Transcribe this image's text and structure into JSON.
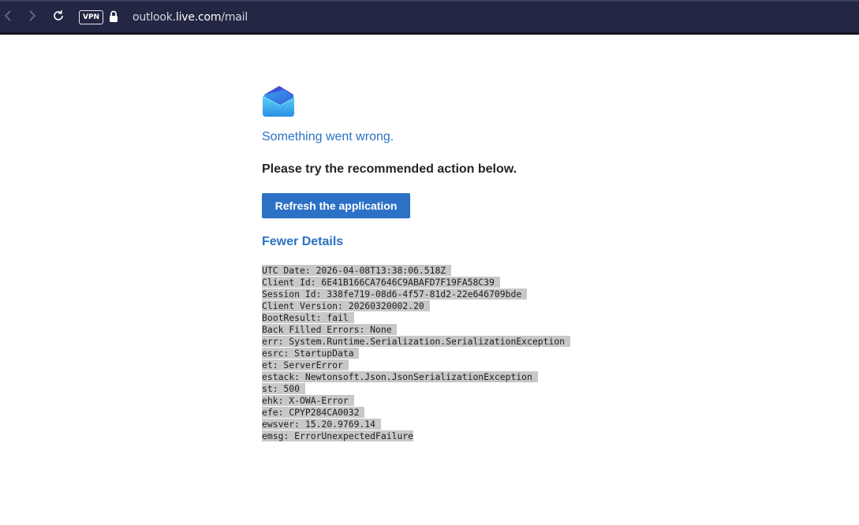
{
  "browser": {
    "back_icon": "chevron-left-icon",
    "forward_icon": "chevron-right-icon",
    "reload_icon": "reload-icon",
    "vpn_label": "VPN",
    "lock_icon": "lock-icon",
    "url_prefix": "outlook.",
    "url_host": "live.com",
    "url_path": "/mail"
  },
  "error": {
    "logo_icon": "outlook-envelope-logo",
    "title": "Something went wrong.",
    "subtitle": "Please try the recommended action below.",
    "refresh_label": "Refresh the application",
    "details_toggle_label": "Fewer Details",
    "details_lines": [
      "UTC Date: 2026-04-08T13:38:06.518Z ",
      "Client Id: 6E41B166CA7646C9ABAFD7F19FA58C39 ",
      "Session Id: 338fe719-08d6-4f57-81d2-22e646709bde ",
      "Client Version: 20260320002.20 ",
      "BootResult: fail ",
      "Back Filled Errors: None ",
      "err: System.Runtime.Serialization.SerializationException ",
      "esrc: StartupData ",
      "et: ServerError ",
      "estack: Newtonsoft.Json.JsonSerializationException ",
      "st: 500 ",
      "ehk: X-OWA-Error ",
      "efe: CPYP284CA0032 ",
      "ewsver: 15.20.9769.14 ",
      "emsg: ErrorUnexpectedFailure"
    ]
  },
  "colors": {
    "browser_bar": "#232743",
    "accent": "#2a72c4",
    "button": "#2b71c6",
    "selection": "#c8c8c8"
  }
}
